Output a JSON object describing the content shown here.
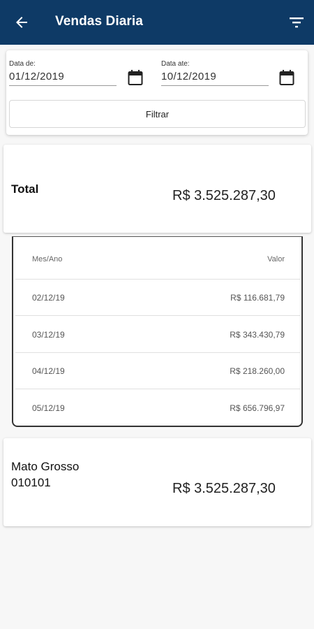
{
  "app": {
    "title": "Vendas Diaria",
    "colors": {
      "appbar": "#0e3a66",
      "background": "#f7f7f7"
    },
    "icons": {
      "back": "arrow-left-icon",
      "filter": "filter-list-icon",
      "calendar": "calendar-icon"
    }
  },
  "filter": {
    "from_label": "Data de:",
    "from_value": "01/12/2019",
    "to_label": "Data ate:",
    "to_value": "10/12/2019",
    "button_label": "Filtrar"
  },
  "total": {
    "label": "Total",
    "value": "R$ 3.525.287,30"
  },
  "table": {
    "headers": [
      "Mes/Ano",
      "Valor"
    ],
    "rows": [
      {
        "date": "02/12/19",
        "value": "R$ 116.681,79"
      },
      {
        "date": "03/12/19",
        "value": "R$ 343.430,79"
      },
      {
        "date": "04/12/19",
        "value": "R$ 218.260,00"
      },
      {
        "date": "05/12/19",
        "value": "R$ 656.796,97"
      }
    ]
  },
  "region": {
    "name": "Mato Grosso",
    "code": "010101",
    "value": "R$ 3.525.287,30"
  }
}
